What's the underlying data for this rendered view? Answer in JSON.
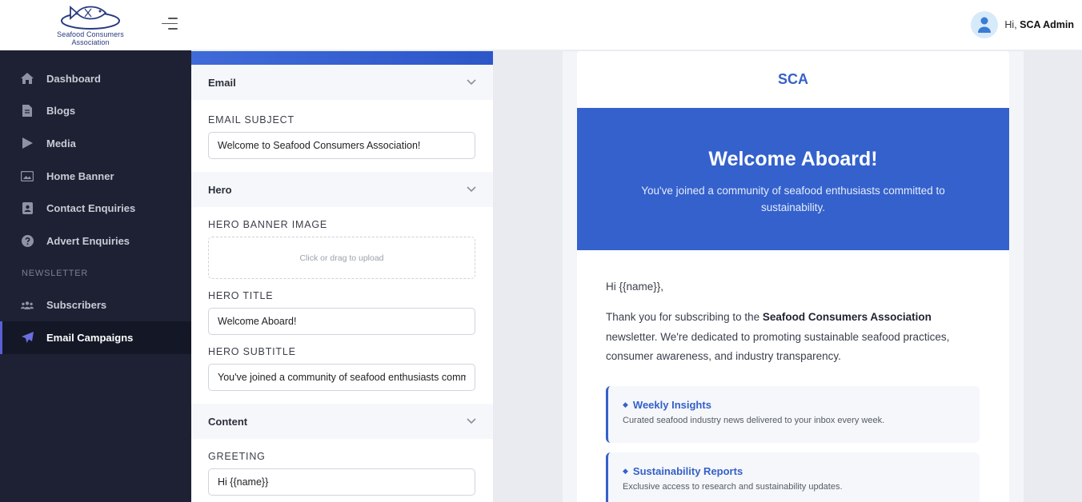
{
  "brand": {
    "logo_line1": "Seafood Consumers",
    "logo_line2": "Association"
  },
  "sidebar": {
    "items": [
      {
        "label": "Dashboard",
        "icon": "home-icon"
      },
      {
        "label": "Blogs",
        "icon": "document-icon"
      },
      {
        "label": "Media",
        "icon": "play-icon"
      },
      {
        "label": "Home Banner",
        "icon": "image-icon"
      },
      {
        "label": "Contact Enquiries",
        "icon": "contact-card-icon"
      },
      {
        "label": "Advert Enquiries",
        "icon": "question-icon"
      }
    ],
    "section_label": "NEWSLETTER",
    "section_items": [
      {
        "label": "Subscribers",
        "icon": "users-icon"
      },
      {
        "label": "Email Campaigns",
        "icon": "paper-plane-icon",
        "active": true
      }
    ]
  },
  "topbar": {
    "greeting_prefix": "Hi,",
    "user_name": "SCA Admin"
  },
  "editor": {
    "sections": {
      "email": "Email",
      "hero": "Hero",
      "content": "Content"
    },
    "fields": {
      "email_subject_label": "EMAIL SUBJECT",
      "email_subject_value": "Welcome to Seafood Consumers Association!",
      "hero_banner_label": "HERO BANNER IMAGE",
      "upload_hint": "Click or drag to upload",
      "hero_title_label": "HERO TITLE",
      "hero_title_value": "Welcome Aboard!",
      "hero_subtitle_label": "HERO SUBTITLE",
      "hero_subtitle_value": "You've joined a community of seafood enthusiasts committed to sustainability.",
      "greeting_label": "GREETING",
      "greeting_value": "Hi {{name}}"
    }
  },
  "preview": {
    "brand": "SCA",
    "hero_title": "Welcome Aboard!",
    "hero_subtitle": "You've joined a community of seafood enthusiasts committed to sustainability.",
    "greeting": "Hi {{name}},",
    "intro_before": "Thank you for subscribing to the ",
    "intro_bold": "Seafood Consumers Association",
    "intro_after": " newsletter. We're dedicated to promoting sustainable seafood practices, consumer awareness, and industry transparency.",
    "cards": [
      {
        "title": "Weekly Insights",
        "desc": "Curated seafood industry news delivered to your inbox every week."
      },
      {
        "title": "Sustainability Reports",
        "desc": "Exclusive access to research and sustainability updates."
      }
    ]
  },
  "colors": {
    "sidebar_bg": "#1d2133",
    "accent": "#3560c8",
    "active_indicator": "#5a5fd6"
  }
}
